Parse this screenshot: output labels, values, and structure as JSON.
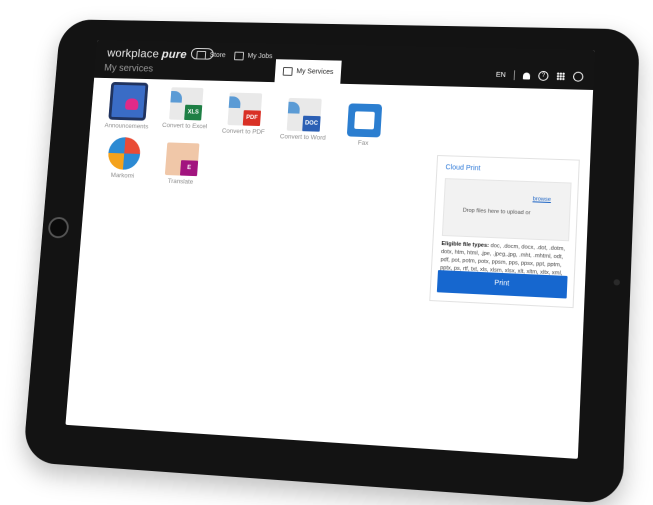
{
  "header": {
    "brand": "workplace",
    "brand_suffix": "pure",
    "tabs": [
      {
        "label": "Store",
        "icon": "store-icon"
      },
      {
        "label": "My Jobs",
        "icon": "printer-icon"
      },
      {
        "label": "My Services",
        "icon": "grid-icon"
      }
    ],
    "language": "EN"
  },
  "section_title": "My services",
  "apps": [
    {
      "label": "Announcements",
      "icon": "announcements-icon"
    },
    {
      "label": "Convert to Excel",
      "icon": "excel-convert-icon",
      "badge": "XLS",
      "badge_color": "#1e7f45"
    },
    {
      "label": "Convert to PDF",
      "icon": "pdf-convert-icon",
      "badge": "PDF",
      "badge_color": "#d93025"
    },
    {
      "label": "Convert to Word",
      "icon": "word-convert-icon",
      "badge": "DOC",
      "badge_color": "#2b5fb4"
    },
    {
      "label": "Fax",
      "icon": "fax-icon"
    },
    {
      "label": "Markomi",
      "icon": "markomi-icon"
    },
    {
      "label": "Translate",
      "icon": "translate-icon",
      "badge": "E",
      "badge_color": "#a2147f"
    }
  ],
  "cloud_print": {
    "title": "Cloud Print",
    "drop_text": "Drop files here to upload or",
    "browse_label": "browse",
    "eligible_label": "Eligible file types:",
    "eligible_types": "doc, .docm, docx, .dot, .dotm, dotx, htm, html, .jpe, .jpeg,.jpg, .mht, .mhtml, odt, pdf, pot, potm, potx, ppsm, pps, ppsx, ppt, pptm, pptx, ps, rtf, txt, xls, xlsm, xlsx, xlt, xltm, xltx, xml, xps",
    "print_label": "Print"
  }
}
